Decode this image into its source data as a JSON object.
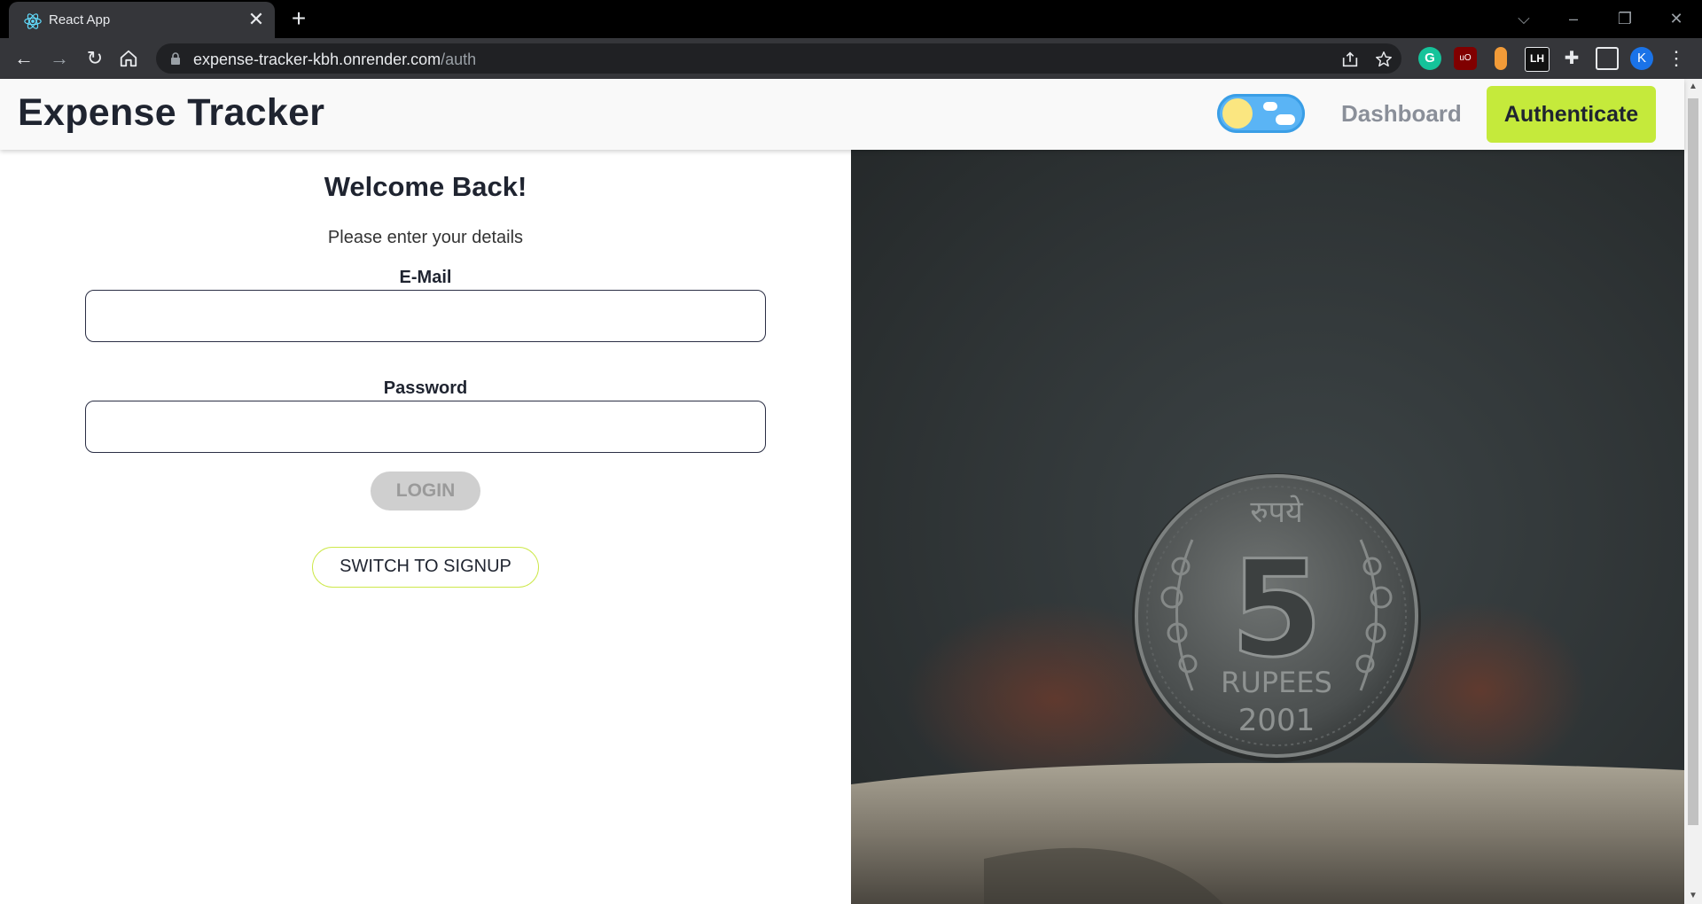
{
  "browser": {
    "tab_title": "React App",
    "tab_close": "✕",
    "new_tab": "+",
    "url_host": "expense-tracker-kbh.onrender.com",
    "url_path": "/auth",
    "profile_initial": "K",
    "ext_lh_label": "LH"
  },
  "navbar": {
    "brand": "Expense Tracker",
    "dashboard_label": "Dashboard",
    "auth_label": "Authenticate"
  },
  "auth": {
    "title": "Welcome Back!",
    "subtitle": "Please enter your details",
    "email_label": "E-Mail",
    "email_value": "",
    "password_label": "Password",
    "password_value": "",
    "login_label": "LOGIN",
    "switch_label": "SWITCH TO SIGNUP"
  },
  "image": {
    "coin_top_text": "रुपये",
    "coin_value": "5",
    "coin_unit": "RUPEES",
    "coin_year": "2001"
  },
  "colors": {
    "accent": "#c5ea3b",
    "toggle_blue": "#5ab4f5",
    "sun": "#fbe680",
    "text_dark": "#1f2430"
  }
}
